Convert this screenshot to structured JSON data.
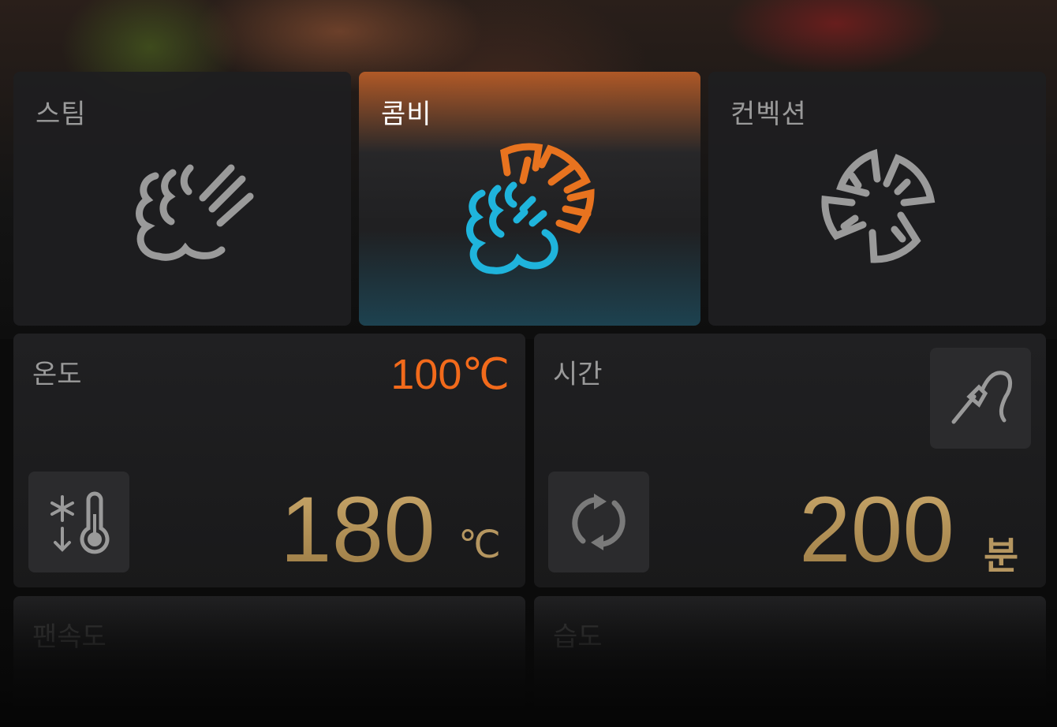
{
  "modes": [
    {
      "id": "steam",
      "label": "스팀",
      "icon": "steam-icon",
      "active": false
    },
    {
      "id": "combi",
      "label": "콤비",
      "icon": "combi-icon",
      "active": true
    },
    {
      "id": "convection",
      "label": "컨벡션",
      "icon": "convection-fan-icon",
      "active": false
    }
  ],
  "temperature": {
    "label": "온도",
    "setpoint": "100℃",
    "value": "180",
    "unit": "℃",
    "button_icon": "cooldown-thermometer-icon"
  },
  "time": {
    "label": "시간",
    "value": "200",
    "unit": "분",
    "probe_icon": "core-probe-icon",
    "button_icon": "continuous-cycle-icon"
  },
  "fan_speed": {
    "label": "팬속도"
  },
  "humidity": {
    "label": "습도"
  },
  "colors": {
    "accent_orange": "#f26a1b",
    "combi_blue": "#1fb4dc",
    "value_gold": "#b8975a",
    "icon_gray": "#9a9a9a"
  }
}
